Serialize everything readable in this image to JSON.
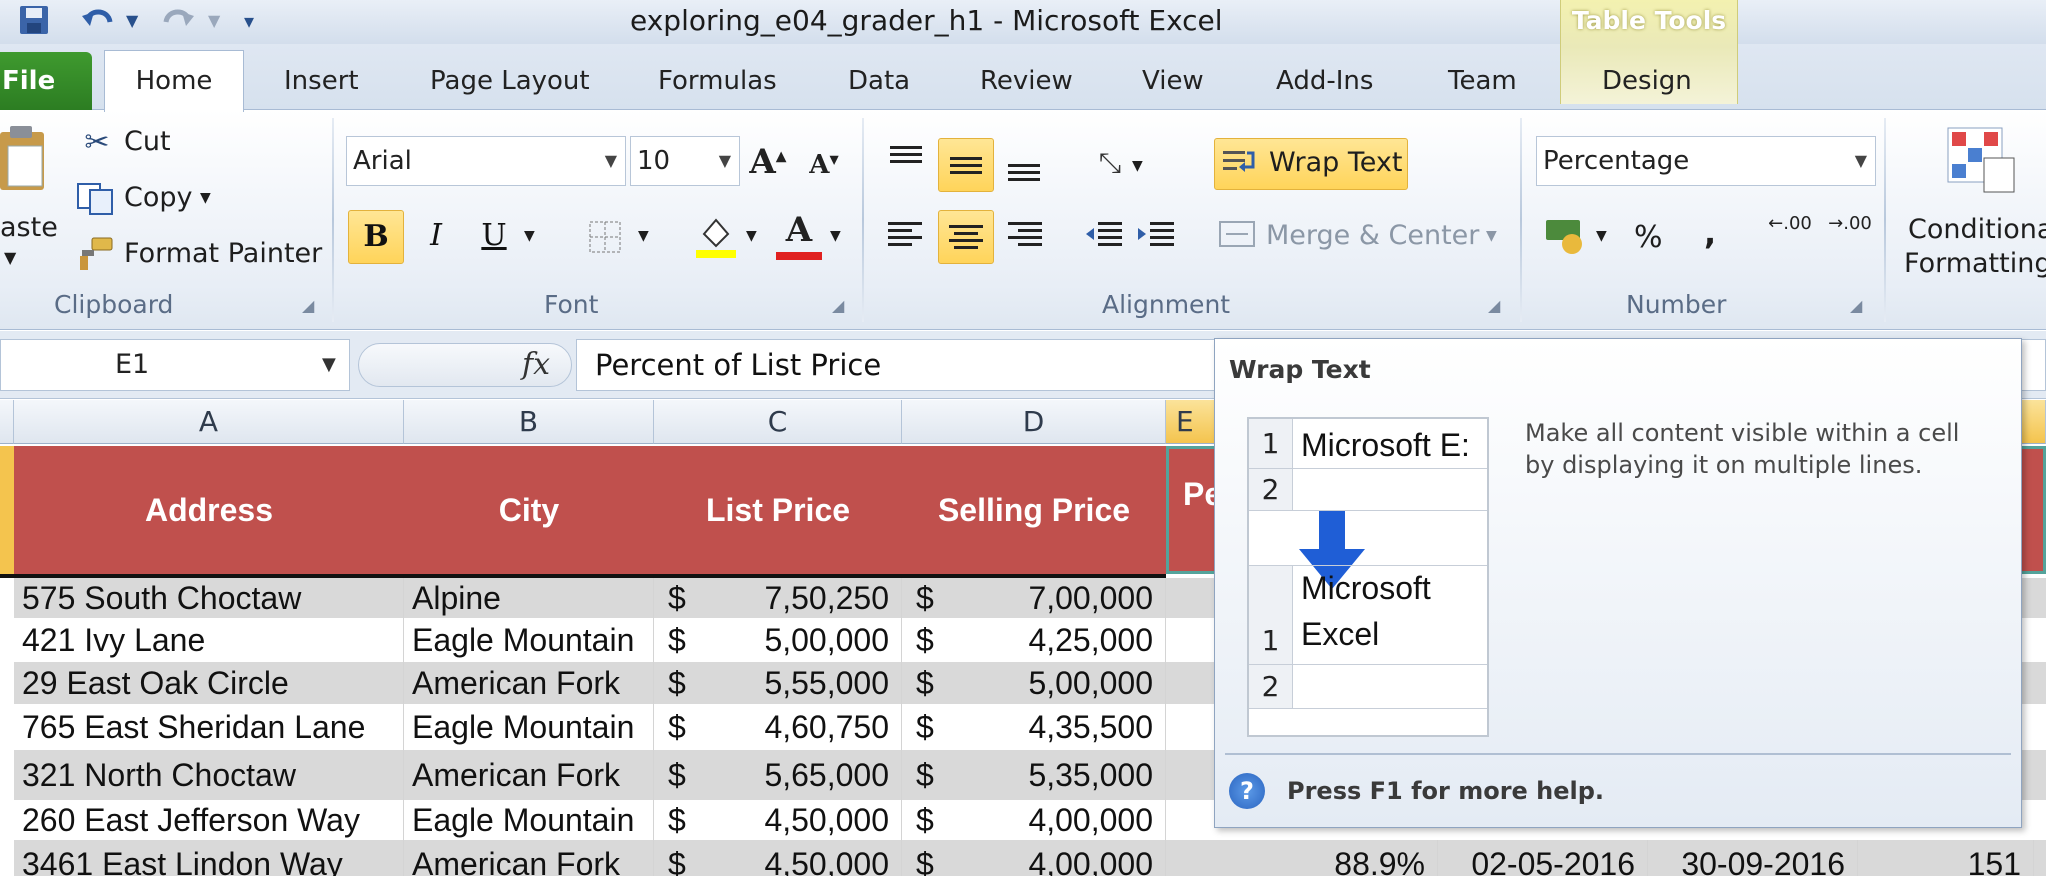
{
  "window": {
    "title": "exploring_e04_grader_h1  -  Microsoft Excel",
    "table_tools": "Table Tools"
  },
  "tabs": {
    "file": "File",
    "home": "Home",
    "insert": "Insert",
    "page_layout": "Page Layout",
    "formulas": "Formulas",
    "data": "Data",
    "review": "Review",
    "view": "View",
    "add_ins": "Add-Ins",
    "team": "Team",
    "design": "Design"
  },
  "ribbon": {
    "clipboard": {
      "paste": "aste",
      "cut": "Cut",
      "copy": "Copy",
      "format_painter": "Format Painter",
      "label": "Clipboard"
    },
    "font": {
      "font_name": "Arial",
      "font_size": "10",
      "bold": "B",
      "italic": "I",
      "underline": "U",
      "label": "Font"
    },
    "alignment": {
      "wrap_text": "Wrap Text",
      "merge_center": "Merge & Center",
      "label": "Alignment"
    },
    "number": {
      "format": "Percentage",
      "percent": "%",
      "comma": ",",
      "increase_decimal": ".00",
      "decrease_decimal": ".00",
      "label": "Number"
    },
    "styles": {
      "conditional": "Conditional",
      "formatting": "Formatting"
    }
  },
  "formula_bar": {
    "name_box": "E1",
    "fx": "fx",
    "content": "Percent of List Price"
  },
  "columns": [
    "A",
    "B",
    "C",
    "D",
    "E"
  ],
  "table": {
    "headers": [
      "Address",
      "City",
      "List Price",
      "Selling Price",
      "Pe"
    ],
    "currency_symbol": "$",
    "rows": [
      {
        "address": "575 South Choctaw",
        "city": "Alpine",
        "list_price": "7,50,250",
        "selling_price": "7,00,000"
      },
      {
        "address": "421 Ivy Lane",
        "city": "Eagle Mountain",
        "list_price": "5,00,000",
        "selling_price": "4,25,000"
      },
      {
        "address": "29 East Oak Circle",
        "city": "American Fork",
        "list_price": "5,55,000",
        "selling_price": "5,00,000"
      },
      {
        "address": "765 East Sheridan Lane",
        "city": "Eagle Mountain",
        "list_price": "4,60,750",
        "selling_price": "4,35,500"
      },
      {
        "address": "321 North Choctaw",
        "city": "American Fork",
        "list_price": "5,65,000",
        "selling_price": "5,35,000"
      },
      {
        "address": "260 East Jefferson Way",
        "city": "Eagle Mountain",
        "list_price": "4,50,000",
        "selling_price": "4,00,000"
      },
      {
        "address": "3461 East Lindon Way",
        "city": "American Fork",
        "list_price": "4,50,000",
        "selling_price": "4,00,000",
        "percent": "88.9%",
        "date1": "02-05-2016",
        "date2": "30-09-2016",
        "days": "151"
      }
    ]
  },
  "tooltip": {
    "title": "Wrap Text",
    "description": "Make all content visible within a cell by displaying it on multiple lines.",
    "help": "Press F1 for more help.",
    "help_icon": "?",
    "preview": {
      "before_text": "Microsoft E:",
      "after_line1": "Microsoft",
      "after_line2": "Excel",
      "row1": "1",
      "row2": "2"
    }
  },
  "colors": {
    "table_header": "#c0504d",
    "band_gray": "#d9d9d9",
    "highlight": "#ffd45a",
    "file_tab": "#2c7d22"
  }
}
